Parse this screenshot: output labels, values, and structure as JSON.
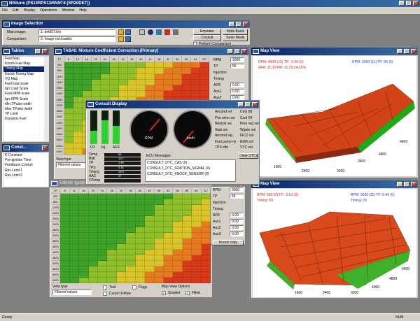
{
  "app": {
    "title": "NIStune (PS13RPS13/6NNT4 (SR20DET))",
    "menu": [
      "File",
      "Edit",
      "Display",
      "Operations",
      "Window",
      "Help"
    ],
    "status": "Ready",
    "status_num": "NUM"
  },
  "image_selection": {
    "title": "Image Selection",
    "main_label": "Main image:",
    "main_value": "1: det657.bin",
    "comp_label": "Comparison:",
    "comp_value": "2: Image not loaded",
    "btn_emulator": "Emulator",
    "btn_consult": "Consult",
    "btn_wideband": "Wide Band",
    "btn_tuner": "Tuner Mode",
    "perform_label": "Perform Comparison"
  },
  "tables": {
    "title": "Tables",
    "items": [
      "Fuel Map",
      "Knock Fuel Map",
      "Timing Map",
      "Knock Timing Map",
      "VQ Map",
      "Fuel load scale",
      "Ign Load Scale",
      "Fuel RPM scale",
      "Ign RPM Scale",
      "Min TPulse width",
      "Max TPulse width",
      "TP Limit",
      "Dynamic Fuel"
    ]
  },
  "constants": {
    "title": "Const...",
    "items": [
      "K Constant",
      "Pre-ignition Time",
      "Feedback Control",
      "Rev Limit 1",
      "Rev Limit 2"
    ]
  },
  "mixture": {
    "title": "TAB#6: Mixture Coefficient Correction (Primary)",
    "cols": [
      "TP",
      "8",
      "12",
      "16",
      "20",
      "24",
      "28",
      "32",
      "36",
      "40",
      "44",
      "48",
      "52",
      "56",
      "60",
      "64",
      "117"
    ],
    "rows": [
      "400",
      "800",
      "1200",
      "1600",
      "2000",
      "2400",
      "2800",
      "3200",
      "3600",
      "4000",
      "4400",
      "4800",
      "5200",
      "5600",
      "6000",
      "6400"
    ]
  },
  "timing": {
    "title": "TAB#8: Ignition Timing",
    "rows": [
      "400",
      "800",
      "1200",
      "1600",
      "2000",
      "2400",
      "2800",
      "3200",
      "3600",
      "4000",
      "4400",
      "4800",
      "5200",
      "5600",
      "6000",
      "6400"
    ],
    "view_type_label": "View type",
    "view_type_value": "Filtered values",
    "trail": "Trail",
    "flags": "Flags",
    "cursor_follow": "Cursor Follow",
    "map_view_options": "Map View Options",
    "shaded": "Shaded",
    "filled": "Filled"
  },
  "side_values": {
    "rpm_label": "RPM",
    "rpm": "3000",
    "tp_label": "TP",
    "tp": "56",
    "injection": "Injection",
    "timing": "Timing",
    "afr": "AFR",
    "afr_v": "0.00",
    "aux1": "Aux1",
    "aux1_v": "0.00",
    "aux2": "Aux2",
    "aux2_v": "0.00",
    "aux3": "Aux3",
    "aux3_v": "0.00",
    "knock": "Knock copy"
  },
  "mixture_view": {
    "title": "Map View",
    "l1": "RPM: 4000 (12)  TP: -0.00 (0)",
    "l2": "AFR: 11.03  PW: 10.29  24.16%",
    "r1": "RPM: 3000 (11)  TP: 56 (6)",
    "xlabels": [
      "3600",
      "4800",
      "6400",
      "1600",
      "2400",
      "3200"
    ]
  },
  "timing_view": {
    "title": "Map View",
    "l1": "RPM: 600 (0)  TP: -0.01 (0)",
    "l2": "Timing: 59",
    "r1": "RPM: 3000 (11)  TP: 0.46 (6)",
    "r2": "Timing: 25",
    "xlabels": [
      "1600",
      "2400",
      "3200",
      "4000",
      "4800",
      "6400"
    ]
  },
  "consult": {
    "title": "Consult Display",
    "bars": [
      "O2",
      "Inj",
      "AFR"
    ],
    "right": [
      [
        "Aircond rel",
        "Cool 88"
      ],
      [
        "Pwr steer sw",
        "Cool 04"
      ],
      [
        "Neutral sw",
        "Pres reg sol"
      ],
      [
        "Start sw",
        "Wgate sol"
      ],
      [
        "Aircond sig",
        "FICD sol"
      ],
      [
        "Fuel pump rly",
        "EGR sol"
      ],
      [
        "TPS idle",
        "VTC sol"
      ]
    ],
    "clear": "Clear DTCs",
    "ecu_label": "ECU Messages",
    "messages": [
      "CONSULT_DTC_CAS (0)",
      "CONSULT_DTC_IGNITION_SIGNAL (0)",
      "CONSULT_DTC_KNOCK_SENSOR (0)"
    ],
    "sensors": [
      [
        "Temp",
        "88"
      ],
      [
        "Batt",
        "13.7"
      ],
      [
        "TP",
        "1.66"
      ],
      [
        "TPS",
        "0.34"
      ],
      [
        "Timing",
        "16.0"
      ],
      [
        "AAC",
        "27"
      ],
      [
        "OTemp",
        ""
      ]
    ],
    "gauge_rpm": "RPM",
    "gauge_spd": "km/h",
    "view_type_value": "Filtered values",
    "view_type_label": "View type"
  },
  "colors": {
    "green": "#3fa32a",
    "yellow": "#d9c52a",
    "orange": "#e67a1f",
    "red": "#d63a1a",
    "title_blue": "#0a246a"
  }
}
